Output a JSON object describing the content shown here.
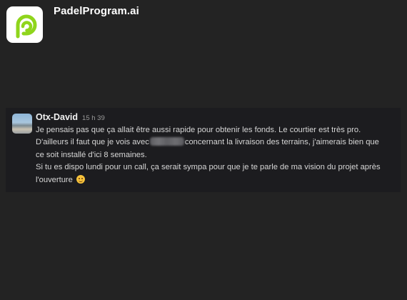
{
  "brand": {
    "name": "PadelProgram.ai",
    "logo_icon": "padel-p-logo-icon",
    "logo_color": "#8fd51c"
  },
  "message": {
    "author": "Otx-David",
    "timestamp": "15 h 39",
    "lines": [
      "Je pensais pas que ça allait être aussi rapide pour obtenir les fonds. Le courtier est très pro.",
      "D'ailleurs il faut que je vois avec",
      "concernant la livraison des terrains, j'aimerais bien que",
      "ce soit installé d'ici 8 semaines.",
      "Si tu es dispo lundi pour un call, ça serait sympa pour que je te parle de ma vision du projet après",
      "l'ouverture"
    ],
    "emoji_icon": "smirk-emoji-icon"
  }
}
